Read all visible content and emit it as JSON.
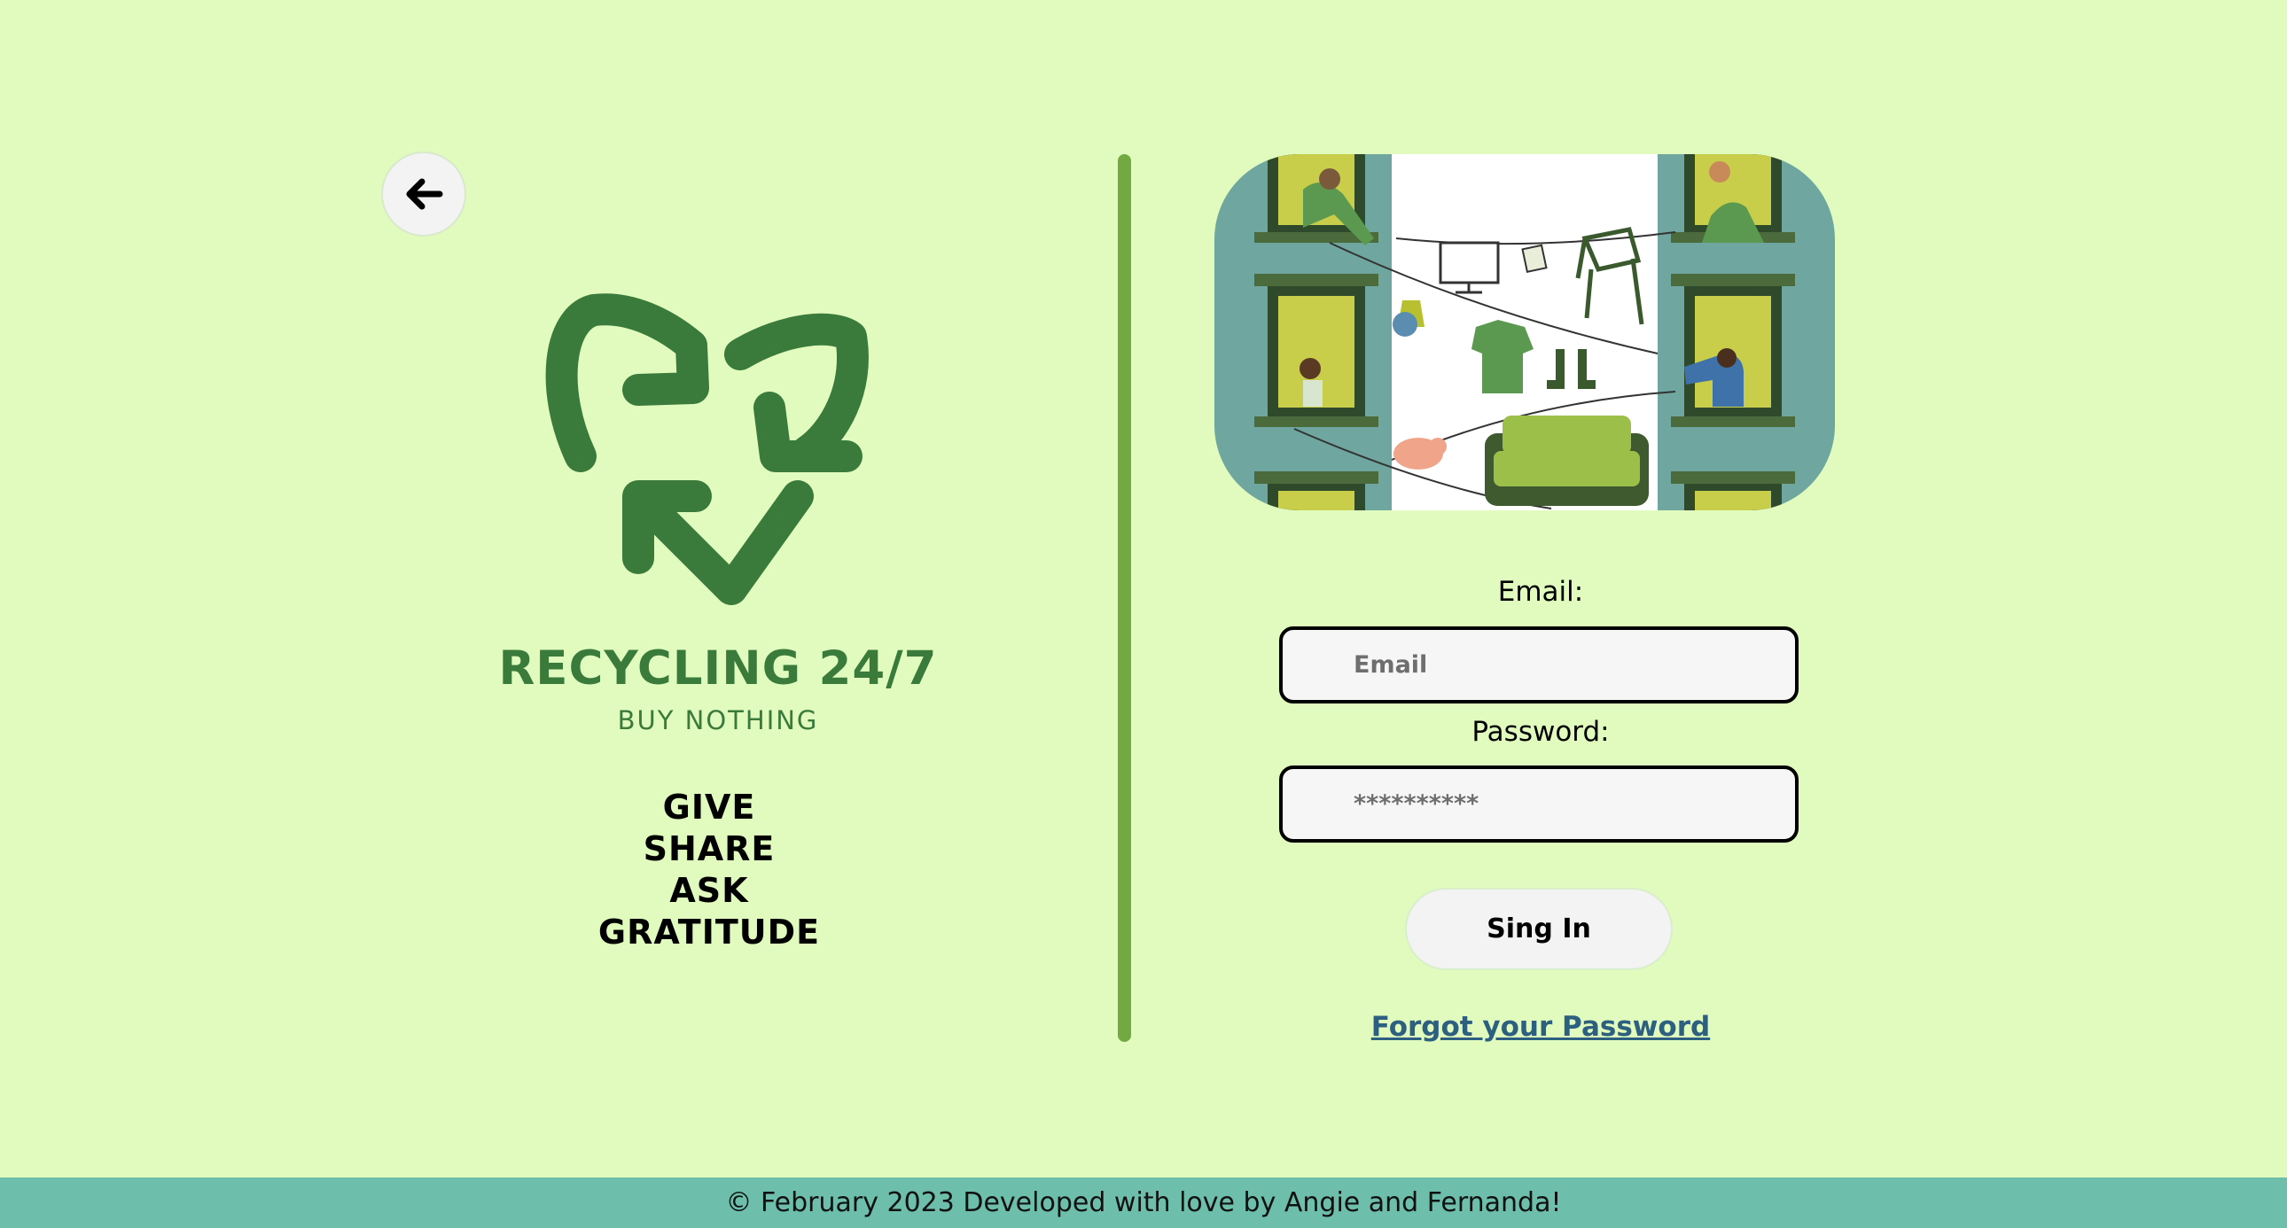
{
  "colors": {
    "background": "#e0fbbd",
    "brand_green": "#3a7b3c",
    "divider": "#72a941",
    "footer": "#6dbfab",
    "link": "#2d5f80"
  },
  "nav": {
    "back_icon": "arrow-left-icon"
  },
  "brand": {
    "logo_icon": "recycle-icon",
    "title": "RECYCLING 24/7",
    "subtitle": "BUY NOTHING",
    "mottos": [
      "GIVE",
      "SHARE",
      "ASK",
      "GRATITUDE"
    ]
  },
  "form": {
    "email_label": "Email:",
    "email_placeholder": "Email",
    "password_label": "Password:",
    "password_placeholder": "**********",
    "signin_label": "Sing In",
    "forgot_label": "Forgot your Password"
  },
  "footer": {
    "text": "© February 2023 Developed with love by Angie and Fernanda!"
  }
}
